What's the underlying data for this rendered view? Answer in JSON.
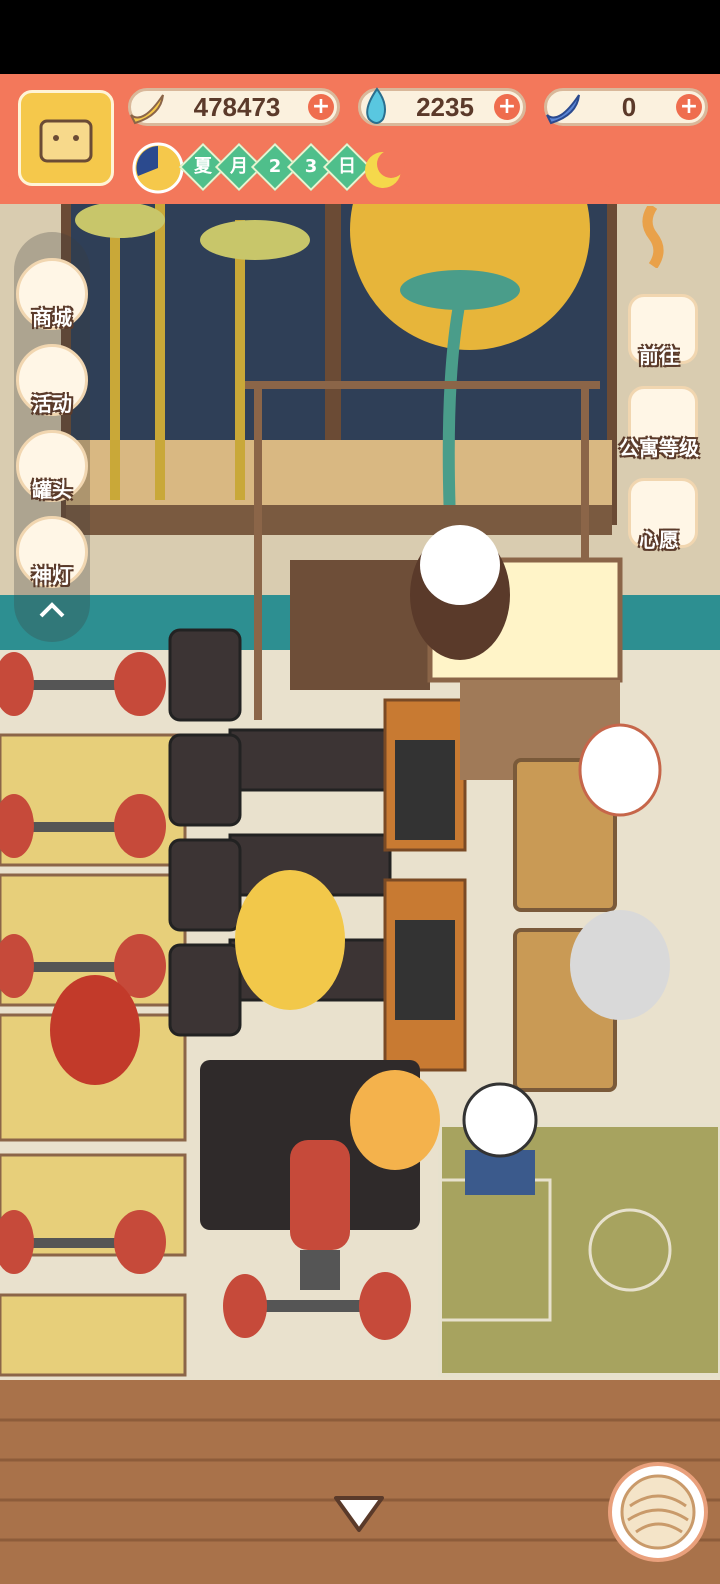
{
  "hud": {
    "bananas": "478473",
    "flames": "2235",
    "gems": "0",
    "date": {
      "chars": [
        "夏",
        "月",
        "2",
        "3",
        "日"
      ]
    },
    "icons": {
      "banana": "banana-icon",
      "flame": "blue-flame-icon",
      "gem": "blue-banana-icon",
      "add": "plus-icon",
      "moon": "moon-night-icon",
      "clock": "day-clock-icon"
    }
  },
  "left_menu": {
    "items": [
      {
        "label": "商城",
        "icon": "shop-icon"
      },
      {
        "label": "活动",
        "icon": "gift-icon"
      },
      {
        "label": "罐头",
        "icon": "can-icon"
      },
      {
        "label": "神灯",
        "icon": "magic-lamp-icon"
      }
    ]
  },
  "right_menu": {
    "items": [
      {
        "label": "前往",
        "icon": "map-pin-icon"
      },
      {
        "label": "公寓等级",
        "icon": "sun-cat-icon"
      },
      {
        "label": "心愿",
        "icon": "heart-book-icon"
      }
    ]
  },
  "colors": {
    "hud": "#f3785b",
    "floor": "#e9e1cd",
    "accent": "#4fbf8b"
  }
}
